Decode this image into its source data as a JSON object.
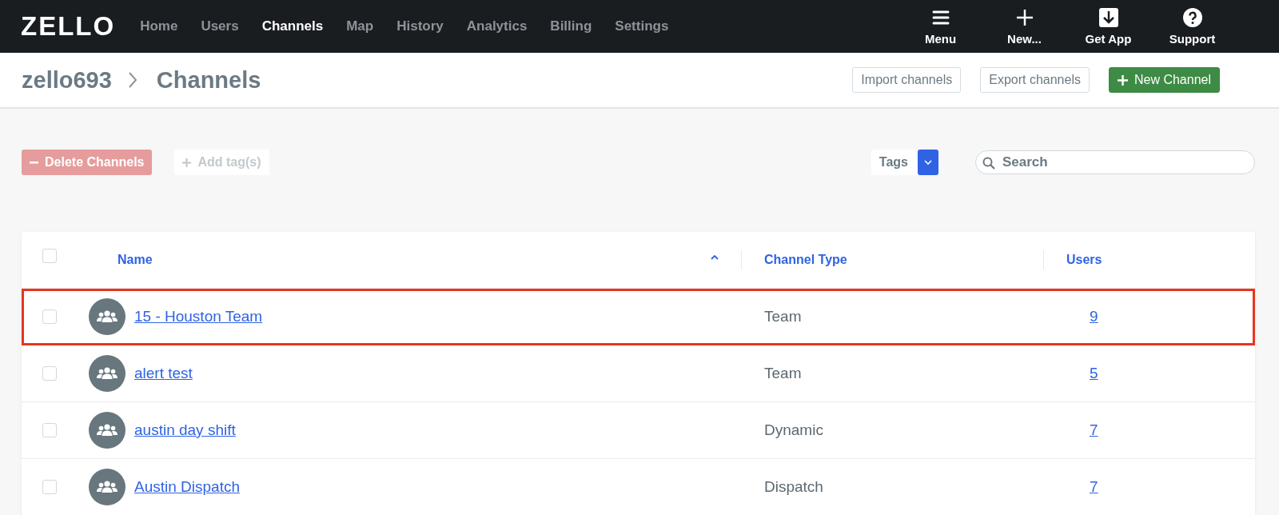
{
  "nav": {
    "logo": "ZELLO",
    "items": [
      {
        "label": "Home",
        "selected": false
      },
      {
        "label": "Users",
        "selected": false
      },
      {
        "label": "Channels",
        "selected": true
      },
      {
        "label": "Map",
        "selected": false
      },
      {
        "label": "History",
        "selected": false
      },
      {
        "label": "Analytics",
        "selected": false
      },
      {
        "label": "Billing",
        "selected": false
      },
      {
        "label": "Settings",
        "selected": false
      }
    ],
    "actions": [
      {
        "kind": "menu",
        "label": "Menu"
      },
      {
        "kind": "new",
        "label": "New..."
      },
      {
        "kind": "download",
        "label": "Get App"
      },
      {
        "kind": "help",
        "label": "Support"
      }
    ]
  },
  "breadcrumb": [
    "zello693",
    "Channels"
  ],
  "header_buttons": [
    {
      "kind": "outline",
      "label": "Import channels"
    },
    {
      "kind": "outline",
      "label": "Export channels"
    },
    {
      "kind": "primary",
      "label": "New Channel"
    }
  ],
  "toolbar": {
    "delete": {
      "label": "Delete Channels",
      "disabled": true
    },
    "add_tag": {
      "label": "Add tag(s)",
      "disabled": true
    },
    "tags": "Tags",
    "search": {
      "placeholder": "Search"
    }
  },
  "table": {
    "select_all": {
      "checked": false
    },
    "columns": [
      {
        "label": "Name",
        "sorted": true
      },
      {
        "label": "Channel Type",
        "sorted": false
      },
      {
        "label": "Users",
        "sorted": false
      }
    ],
    "rows": [
      {
        "name": "15 - Houston Team",
        "type": "Team",
        "users": "9",
        "checked": false,
        "highlighted": true
      },
      {
        "name": "alert test",
        "type": "Team",
        "users": "5",
        "checked": false,
        "highlighted": false
      },
      {
        "name": "austin day shift",
        "type": "Dynamic",
        "users": "7",
        "checked": false,
        "highlighted": false
      },
      {
        "name": "Austin Dispatch",
        "type": "Dispatch",
        "users": "7",
        "checked": false,
        "highlighted": false
      }
    ]
  }
}
